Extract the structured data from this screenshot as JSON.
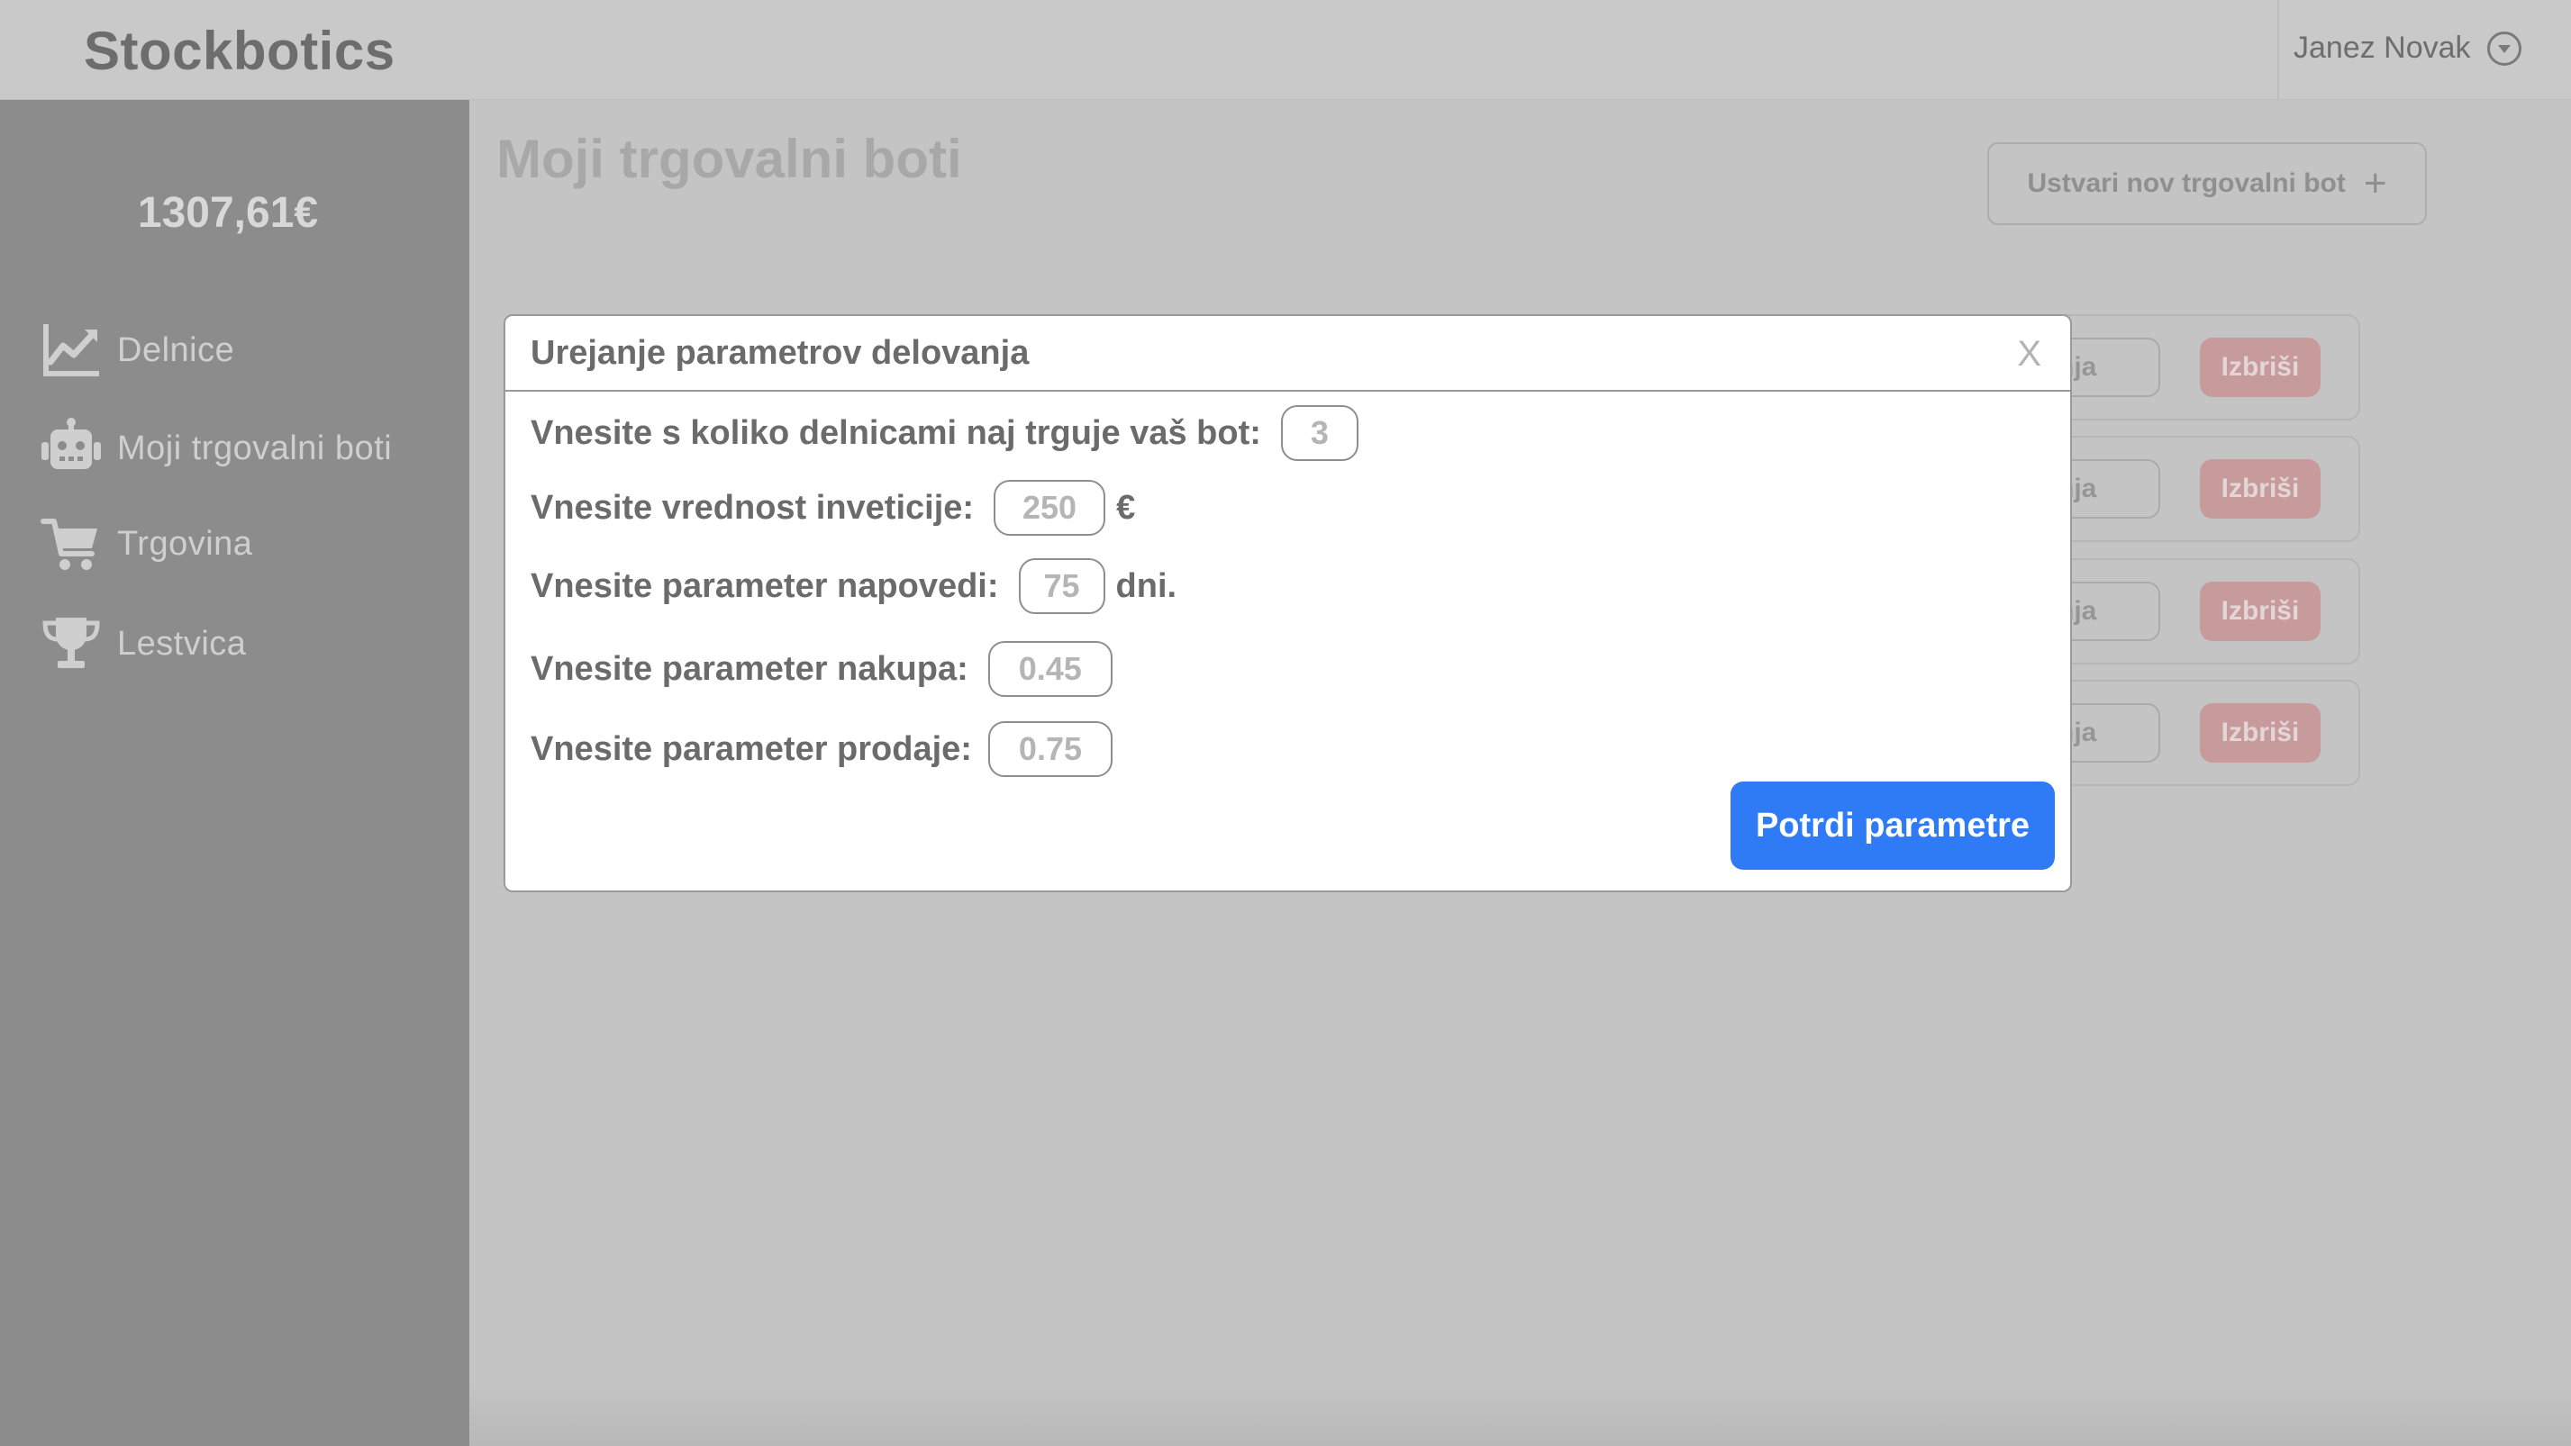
{
  "header": {
    "logo": "Stockbotics",
    "user_name": "Janez Novak"
  },
  "sidebar": {
    "balance": "1307,61€",
    "items": [
      {
        "label": "Delnice",
        "icon": "chart-line-icon"
      },
      {
        "label": "Moji trgovalni boti",
        "icon": "robot-icon"
      },
      {
        "label": "Trgovina",
        "icon": "cart-icon"
      },
      {
        "label": "Lestvica",
        "icon": "trophy-icon"
      }
    ]
  },
  "main": {
    "title": "Moji trgovalni boti",
    "create_button": "Ustvari nov trgovalni bot",
    "create_button_icon": "plus-icon",
    "bots": [
      {
        "edit_label": "vanja",
        "delete_label": "Izbriši"
      },
      {
        "edit_label": "vanja",
        "delete_label": "Izbriši"
      },
      {
        "edit_label": "vanja",
        "delete_label": "Izbriši"
      },
      {
        "edit_label": "vanja",
        "delete_label": "Izbriši"
      }
    ]
  },
  "modal": {
    "title": "Urejanje parametrov delovanja",
    "close_label": "X",
    "fields": [
      {
        "label": "Vnesite s koliko delnicami naj trguje vaš bot:",
        "value": "3",
        "unit": ""
      },
      {
        "label": "Vnesite vrednost inveticije:",
        "value": "250",
        "unit": "€"
      },
      {
        "label": "Vnesite parameter napovedi:",
        "value": "75",
        "unit": "dni."
      },
      {
        "label": "Vnesite parameter nakupa:",
        "value": "0.45",
        "unit": ""
      },
      {
        "label": "Vnesite parameter prodaje:",
        "value": "0.75",
        "unit": ""
      }
    ],
    "confirm_button": "Potrdi parametre"
  },
  "colors": {
    "accent": "#2f7bf5",
    "delete": "#c79b9b",
    "sidebar": "#8c8c8c",
    "overlay": "#c4c4c4"
  }
}
